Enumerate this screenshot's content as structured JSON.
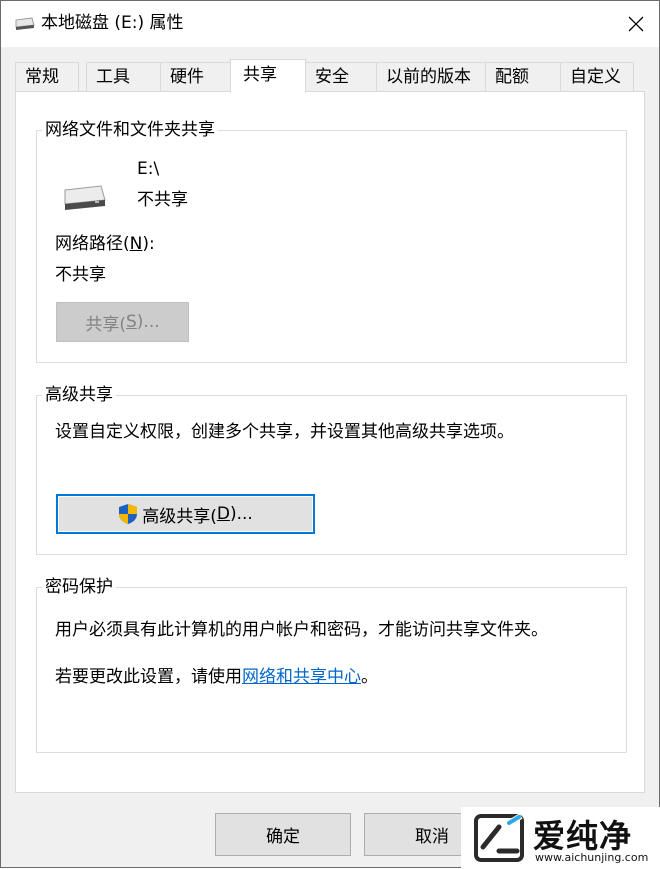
{
  "window": {
    "title": "本地磁盘 (E:) 属性",
    "icons": {
      "title": "drive-icon",
      "close": "close-icon"
    }
  },
  "tabs": [
    {
      "label": "常规"
    },
    {
      "label": "工具"
    },
    {
      "label": "硬件"
    },
    {
      "label": "共享",
      "active": true
    },
    {
      "label": "安全"
    },
    {
      "label": "以前的版本"
    },
    {
      "label": "配额"
    },
    {
      "label": "自定义"
    }
  ],
  "network_sharing": {
    "legend": "网络文件和文件夹共享",
    "drive_path": "E:\\",
    "drive_status": "不共享",
    "path_label_pre": "网络路径(",
    "path_label_key": "N",
    "path_label_post": "):",
    "path_value": "不共享",
    "share_btn_pre": "共享(",
    "share_btn_key": "S",
    "share_btn_post": ")...",
    "share_btn_enabled": false,
    "drive_icon": "hard-drive-icon"
  },
  "advanced_sharing": {
    "legend": "高级共享",
    "description": "设置自定义权限，创建多个共享，并设置其他高级共享选项。",
    "button_pre": "高级共享(",
    "button_key": "D",
    "button_post": ")...",
    "button_icon": "uac-shield-icon"
  },
  "password_protection": {
    "legend": "密码保护",
    "line1": "用户必须具有此计算机的用户帐户和密码，才能访问共享文件夹。",
    "line2_pre": "若要更改此设置，请使用",
    "line2_link": "网络和共享中心",
    "line2_post": "。"
  },
  "footer": {
    "ok_label": "确定",
    "cancel_label": "取消"
  },
  "watermark": {
    "text": "爱纯净",
    "url": "www.aichunjing.com",
    "icon": "logo-icon"
  },
  "colors": {
    "link": "#0066cc",
    "focus": "#0078d7",
    "shield_blue": "#1f5fbf",
    "shield_yellow": "#f2b705"
  }
}
